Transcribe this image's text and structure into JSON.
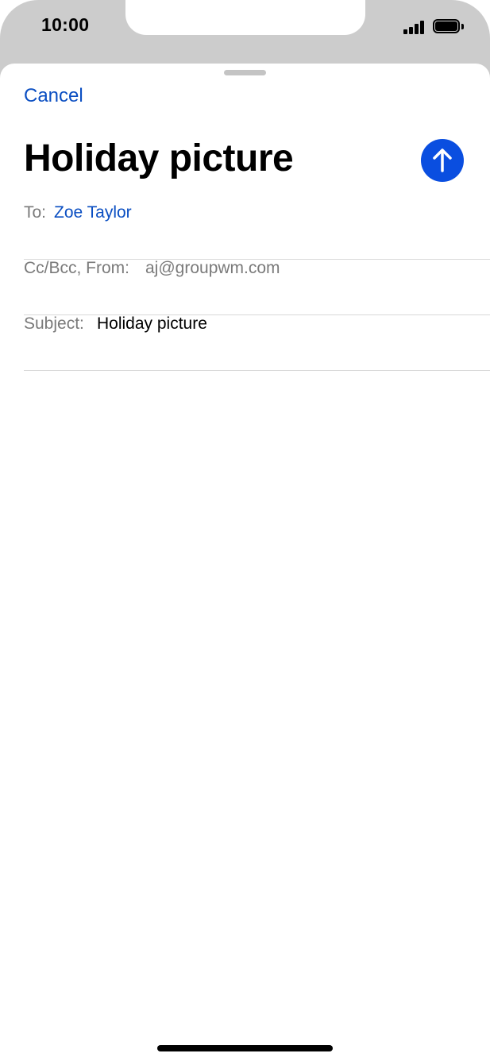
{
  "status_bar": {
    "time": "10:00",
    "icons": [
      "signal-icon",
      "battery-icon"
    ]
  },
  "compose": {
    "cancel_label": "Cancel",
    "title": "Holiday picture",
    "send_icon": "arrow-up-icon",
    "to_label": "To:",
    "to_value": "Zoe Taylor",
    "cc_label": "Cc/Bcc, From:",
    "cc_value": "aj@groupwm.com",
    "subject_label": "Subject:",
    "subject_value": "Holiday picture",
    "body": ""
  },
  "colors": {
    "accent": "#0a4ec2",
    "send_button": "#0a4ee0",
    "status_bar_bg": "#cccccc",
    "label_gray": "#7a7a7a"
  }
}
